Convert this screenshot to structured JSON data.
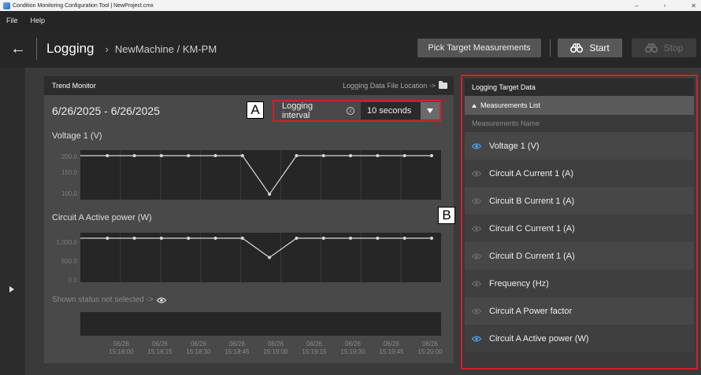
{
  "window": {
    "title": "Condition Monitoring Configuration Tool | NewProject.cmx",
    "controls": [
      "–",
      "▫",
      "✕"
    ]
  },
  "menu": {
    "items": [
      "File",
      "Help"
    ]
  },
  "header": {
    "back_glyph": "←",
    "title": "Logging",
    "breadcrumb_sep": "›",
    "breadcrumb": "NewMachine / KM-PM",
    "pick_label": "Pick Target Measurements",
    "start_label": "Start",
    "stop_label": "Stop"
  },
  "trend": {
    "title": "Trend Monitor",
    "file_location_label": "Logging Data File Location  ->",
    "date_range": "6/26/2025 - 6/26/2025",
    "interval_label": "Logging interval",
    "interval_value": "10 seconds",
    "status_text": "Shown status not selected  ->",
    "charts": [
      {
        "label": "Voltage 1 (V)",
        "yticks": [
          "200.0",
          "150.0",
          "100.0"
        ],
        "values": [
          200,
          200,
          200,
          200,
          200,
          200,
          200,
          100,
          200,
          200,
          200,
          200,
          200,
          200
        ],
        "ymin": 100,
        "ymax": 200
      },
      {
        "label": "Circuit A Active power (W)",
        "yticks": [
          "1,000.0",
          "500.0",
          "0.0"
        ],
        "values": [
          1000,
          1000,
          1000,
          1000,
          1000,
          1000,
          1000,
          500,
          1000,
          1000,
          1000,
          1000,
          1000,
          1000
        ],
        "ymin": 0,
        "ymax": 1000
      }
    ],
    "xticks": [
      {
        "date": "06/26",
        "time": "15:18:00"
      },
      {
        "date": "06/26",
        "time": "15:18:15"
      },
      {
        "date": "06/26",
        "time": "15:18:30"
      },
      {
        "date": "06/26",
        "time": "15:18:45"
      },
      {
        "date": "06/26",
        "time": "15:19:00"
      },
      {
        "date": "06/26",
        "time": "15:19:15"
      },
      {
        "date": "06/26",
        "time": "15:19:30"
      },
      {
        "date": "06/26",
        "time": "15:19:45"
      },
      {
        "date": "06/26",
        "time": "15:20:00"
      }
    ]
  },
  "target": {
    "title": "Logging Target Data",
    "list_header": "Measurements List",
    "column_header": "Measurements Name",
    "items": [
      {
        "name": "Voltage 1 (V)",
        "shown": true
      },
      {
        "name": "Circuit A Current 1 (A)",
        "shown": false
      },
      {
        "name": "Circuit B Current 1 (A)",
        "shown": false
      },
      {
        "name": "Circuit C Current 1 (A)",
        "shown": false
      },
      {
        "name": "Circuit D Current 1 (A)",
        "shown": false
      },
      {
        "name": "Frequency (Hz)",
        "shown": false
      },
      {
        "name": "Circuit A Power factor",
        "shown": false
      },
      {
        "name": "Circuit A Active power (W)",
        "shown": true
      }
    ]
  },
  "callouts": {
    "a": "A",
    "b": "B"
  },
  "colors": {
    "highlight_border": "#d0202a",
    "eye_active": "#4aa3e8",
    "eye_inactive": "#6a6a6a",
    "series_line": "#d8d8d8"
  }
}
